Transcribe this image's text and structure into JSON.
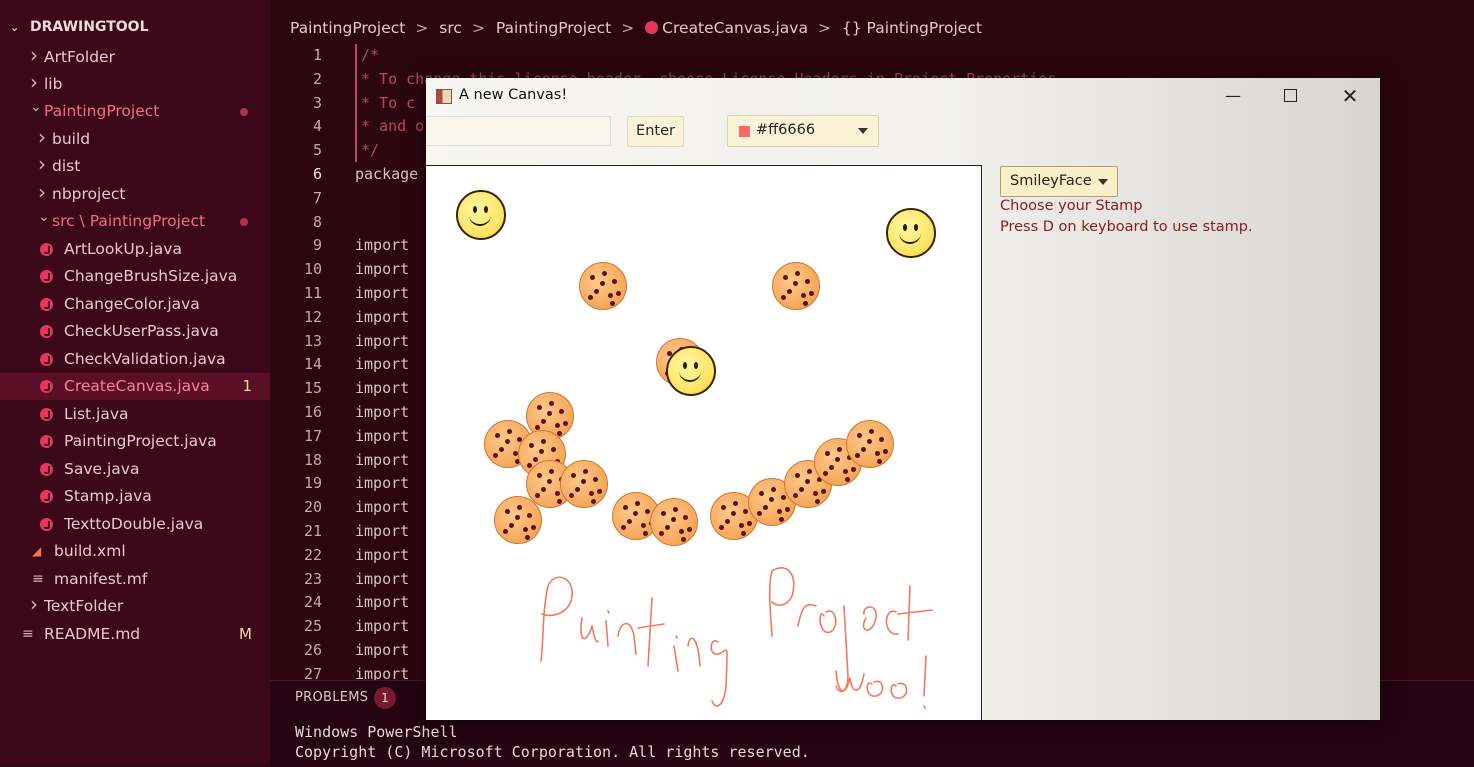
{
  "explorer": {
    "title": "DRAWINGTOOL",
    "items": [
      {
        "label": "ArtFolder",
        "kind": "folder"
      },
      {
        "label": "lib",
        "kind": "folder"
      },
      {
        "label": "PaintingProject",
        "kind": "folder-open"
      },
      {
        "label": "build",
        "kind": "folder"
      },
      {
        "label": "dist",
        "kind": "folder"
      },
      {
        "label": "nbproject",
        "kind": "folder"
      },
      {
        "label": "src \\ PaintingProject",
        "kind": "folder-open"
      },
      {
        "label": "ArtLookUp.java",
        "kind": "java"
      },
      {
        "label": "ChangeBrushSize.java",
        "kind": "java"
      },
      {
        "label": "ChangeColor.java",
        "kind": "java"
      },
      {
        "label": "CheckUserPass.java",
        "kind": "java"
      },
      {
        "label": "CheckValidation.java",
        "kind": "java"
      },
      {
        "label": "CreateCanvas.java",
        "kind": "java",
        "badge": "1"
      },
      {
        "label": "List.java",
        "kind": "java"
      },
      {
        "label": "PaintingProject.java",
        "kind": "java"
      },
      {
        "label": "Save.java",
        "kind": "java"
      },
      {
        "label": "Stamp.java",
        "kind": "java"
      },
      {
        "label": "TexttoDouble.java",
        "kind": "java"
      },
      {
        "label": "build.xml",
        "kind": "xml"
      },
      {
        "label": "manifest.mf",
        "kind": "file"
      },
      {
        "label": "TextFolder",
        "kind": "folder"
      },
      {
        "label": "README.md",
        "kind": "file",
        "badge": "M"
      }
    ]
  },
  "breadcrumb": [
    "PaintingProject",
    "src",
    "PaintingProject",
    "CreateCanvas.java",
    "{} PaintingProject"
  ],
  "code_lines": [
    {
      "n": "1",
      "text": "/*"
    },
    {
      "n": "2",
      "text": " * To change this license header, choose License Headers in Project Properties."
    },
    {
      "n": "3",
      "text": " * To c"
    },
    {
      "n": "4",
      "text": " * and o"
    },
    {
      "n": "5",
      "text": " */"
    },
    {
      "n": "6",
      "text": "package"
    },
    {
      "n": "7",
      "text": ""
    },
    {
      "n": "8",
      "text": ""
    },
    {
      "n": "9",
      "text": "import"
    },
    {
      "n": "10",
      "text": "import"
    },
    {
      "n": "11",
      "text": "import"
    },
    {
      "n": "12",
      "text": "import"
    },
    {
      "n": "13",
      "text": "import"
    },
    {
      "n": "14",
      "text": "import"
    },
    {
      "n": "15",
      "text": "import"
    },
    {
      "n": "16",
      "text": "import"
    },
    {
      "n": "17",
      "text": "import"
    },
    {
      "n": "18",
      "text": "import"
    },
    {
      "n": "19",
      "text": "import"
    },
    {
      "n": "20",
      "text": "import"
    },
    {
      "n": "21",
      "text": "import"
    },
    {
      "n": "22",
      "text": "import"
    },
    {
      "n": "23",
      "text": "import"
    },
    {
      "n": "24",
      "text": "import"
    },
    {
      "n": "25",
      "text": "import"
    },
    {
      "n": "26",
      "text": "import"
    },
    {
      "n": "27",
      "text": "import"
    }
  ],
  "panel": {
    "problems_label": "PROBLEMS",
    "problems_count": "1",
    "terminal_line1": "Windows PowerShell",
    "terminal_line2": "Copyright (C) Microsoft Corporation. All rights reserved."
  },
  "canvas_window": {
    "title": "A new Canvas!",
    "name_value": "",
    "enter_label": "Enter",
    "color_value": "#ff6666",
    "stamp_selected": "SmileyFace",
    "stamp_help_1": "Choose your Stamp",
    "stamp_help_2": "Press D on keyboard to use stamp.",
    "drawing_text_1": "Painting",
    "drawing_text_2": "Project",
    "drawing_text_3": "woo!"
  },
  "colors": {
    "accent": "#e8355e",
    "brush": "#ff6666",
    "help_text": "#8b1a1a"
  }
}
